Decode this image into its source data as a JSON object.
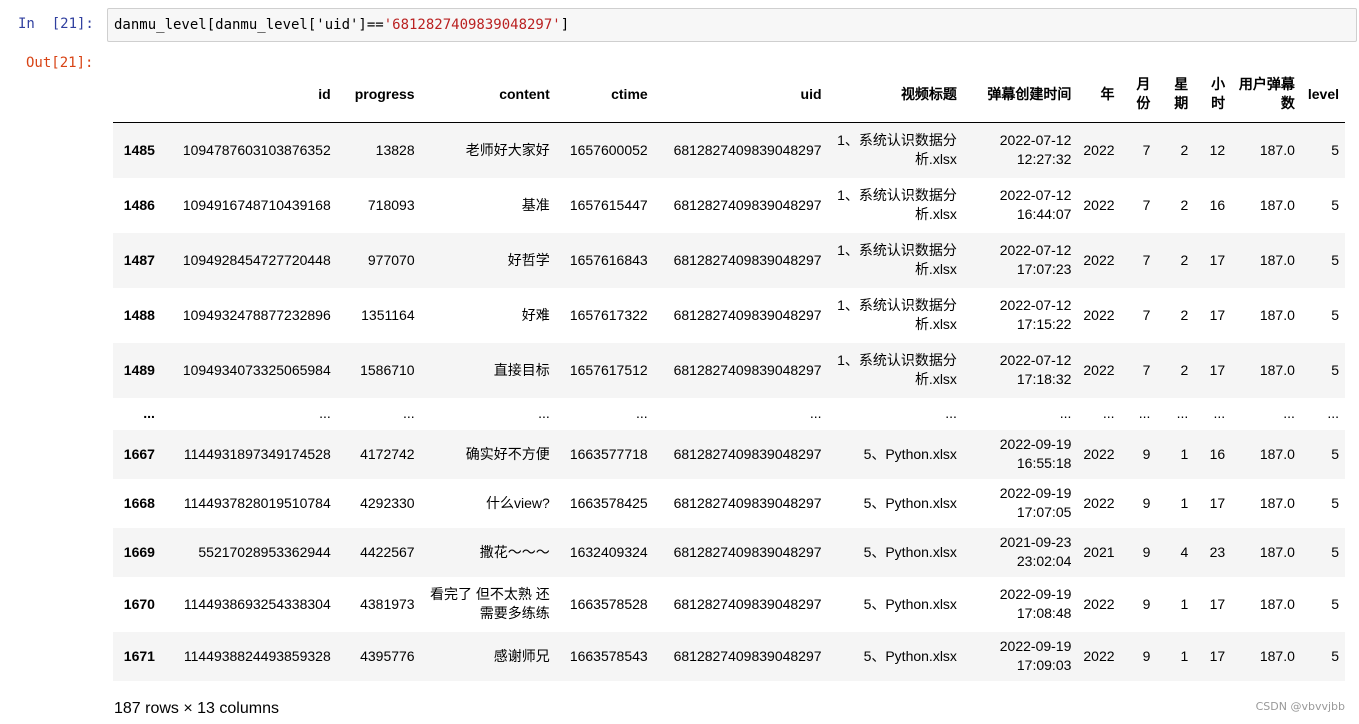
{
  "input_prompt": "In  [21]:",
  "code": {
    "prefix": "danmu_level[danmu_level['uid']==",
    "string": "'6812827409839048297'",
    "suffix": "]"
  },
  "output_prompt": "Out[21]:",
  "table": {
    "columns": [
      "",
      "id",
      "progress",
      "content",
      "ctime",
      "uid",
      "视频标题",
      "弹幕创建时间",
      "年",
      "月份",
      "星期",
      "小时",
      "用户弹幕数",
      "level"
    ],
    "rows": [
      [
        "1485",
        "1094787603103876352",
        "13828",
        "老师好大家好",
        "1657600052",
        "6812827409839048297",
        "1、系统认识数据分析.xlsx",
        "2022-07-12 12:27:32",
        "2022",
        "7",
        "2",
        "12",
        "187.0",
        "5"
      ],
      [
        "1486",
        "1094916748710439168",
        "718093",
        "基准",
        "1657615447",
        "6812827409839048297",
        "1、系统认识数据分析.xlsx",
        "2022-07-12 16:44:07",
        "2022",
        "7",
        "2",
        "16",
        "187.0",
        "5"
      ],
      [
        "1487",
        "1094928454727720448",
        "977070",
        "好哲学",
        "1657616843",
        "6812827409839048297",
        "1、系统认识数据分析.xlsx",
        "2022-07-12 17:07:23",
        "2022",
        "7",
        "2",
        "17",
        "187.0",
        "5"
      ],
      [
        "1488",
        "1094932478877232896",
        "1351164",
        "好难",
        "1657617322",
        "6812827409839048297",
        "1、系统认识数据分析.xlsx",
        "2022-07-12 17:15:22",
        "2022",
        "7",
        "2",
        "17",
        "187.0",
        "5"
      ],
      [
        "1489",
        "1094934073325065984",
        "1586710",
        "直接目标",
        "1657617512",
        "6812827409839048297",
        "1、系统认识数据分析.xlsx",
        "2022-07-12 17:18:32",
        "2022",
        "7",
        "2",
        "17",
        "187.0",
        "5"
      ],
      [
        "...",
        "...",
        "...",
        "...",
        "...",
        "...",
        "...",
        "...",
        "...",
        "...",
        "...",
        "...",
        "...",
        "..."
      ],
      [
        "1667",
        "1144931897349174528",
        "4172742",
        "确实好不方便",
        "1663577718",
        "6812827409839048297",
        "5、Python.xlsx",
        "2022-09-19 16:55:18",
        "2022",
        "9",
        "1",
        "16",
        "187.0",
        "5"
      ],
      [
        "1668",
        "1144937828019510784",
        "4292330",
        "什么view?",
        "1663578425",
        "6812827409839048297",
        "5、Python.xlsx",
        "2022-09-19 17:07:05",
        "2022",
        "9",
        "1",
        "17",
        "187.0",
        "5"
      ],
      [
        "1669",
        "55217028953362944",
        "4422567",
        "撒花～～～",
        "1632409324",
        "6812827409839048297",
        "5、Python.xlsx",
        "2021-09-23 23:02:04",
        "2021",
        "9",
        "4",
        "23",
        "187.0",
        "5"
      ],
      [
        "1670",
        "1144938693254338304",
        "4381973",
        "看完了 但不太熟 还需要多练练",
        "1663578528",
        "6812827409839048297",
        "5、Python.xlsx",
        "2022-09-19 17:08:48",
        "2022",
        "9",
        "1",
        "17",
        "187.0",
        "5"
      ],
      [
        "1671",
        "1144938824493859328",
        "4395776",
        "感谢师兄",
        "1663578543",
        "6812827409839048297",
        "5、Python.xlsx",
        "2022-09-19 17:09:03",
        "2022",
        "9",
        "1",
        "17",
        "187.0",
        "5"
      ]
    ]
  },
  "summary": "187 rows × 13 columns",
  "watermark": "CSDN @vbvvjbb"
}
